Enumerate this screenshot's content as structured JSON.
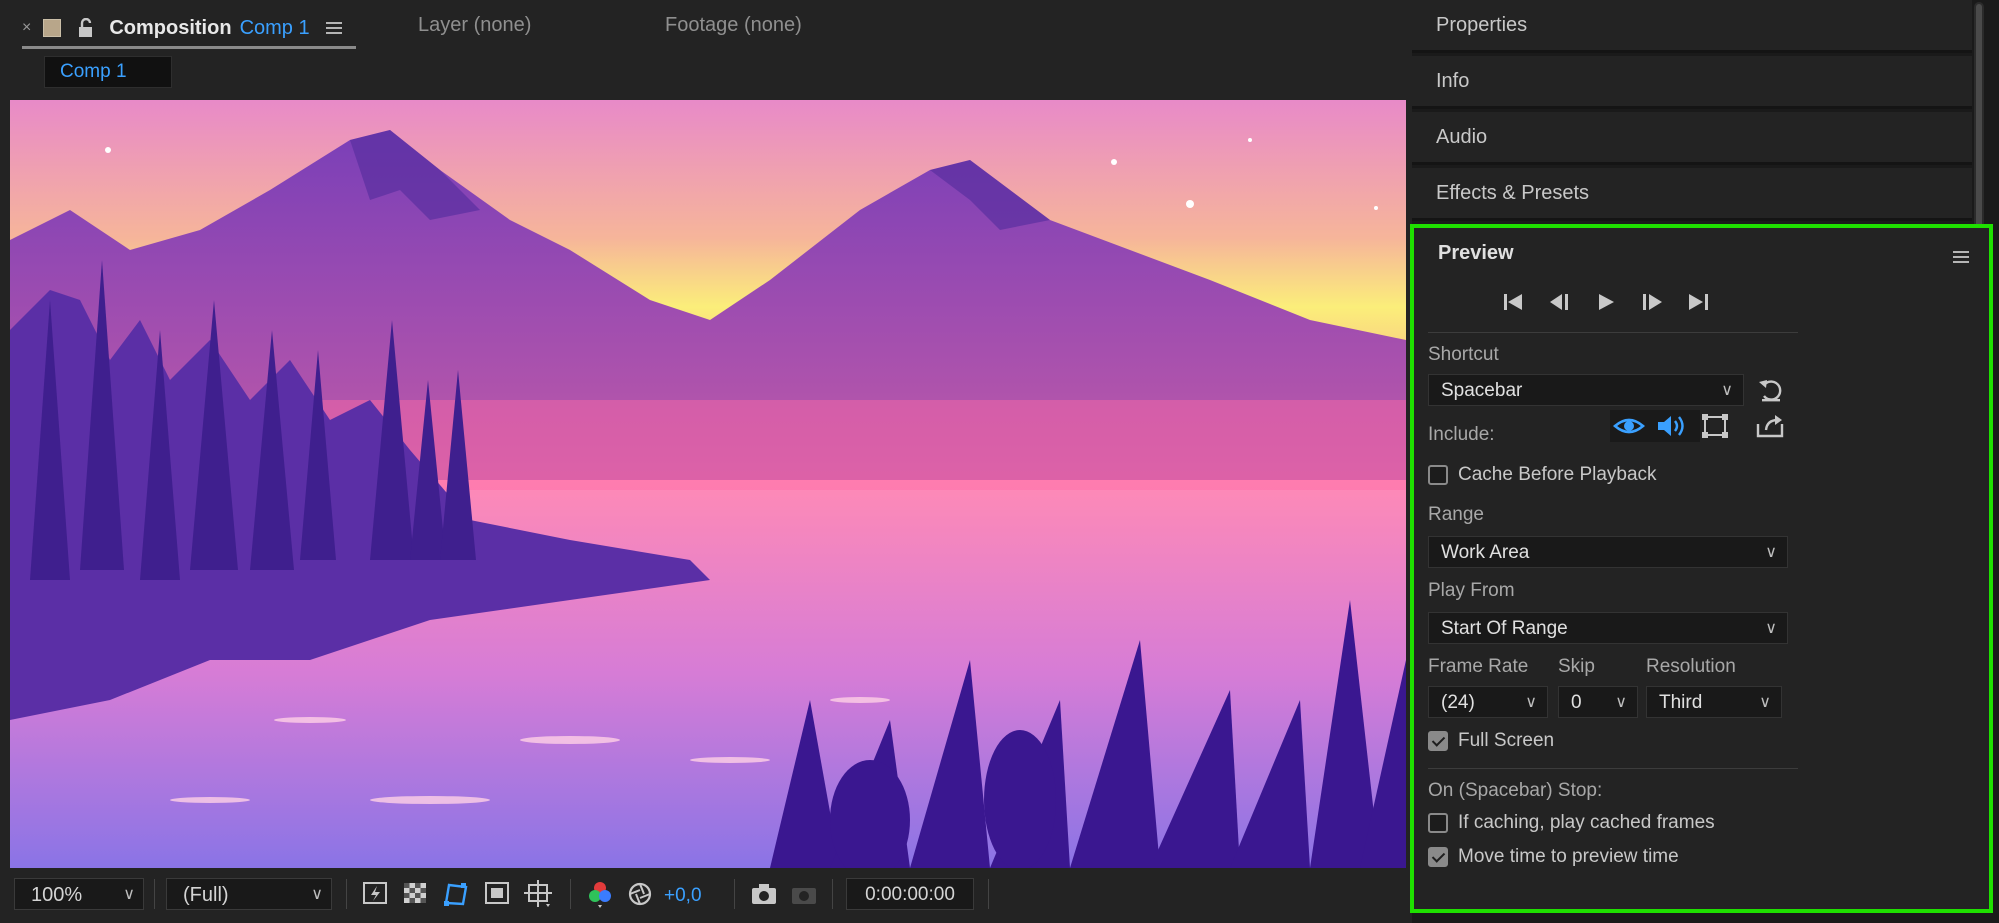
{
  "composition_panel": {
    "tab_composition_label": "Composition",
    "tab_composition_name": "Comp 1",
    "tab_layer": "Layer (none)",
    "tab_footage": "Footage (none)",
    "breadcrumb": "Comp 1"
  },
  "bottom_bar": {
    "zoom": "100%",
    "resolution": "(Full)",
    "exposure": "+0,0",
    "timecode": "0:00:00:00"
  },
  "right_panels": {
    "items": [
      {
        "label": "Properties"
      },
      {
        "label": "Info"
      },
      {
        "label": "Audio"
      },
      {
        "label": "Effects & Presets"
      }
    ]
  },
  "preview": {
    "title": "Preview",
    "shortcut_label": "Shortcut",
    "shortcut_value": "Spacebar",
    "include_label": "Include:",
    "cache_before_playback": "Cache Before Playback",
    "cache_before_playback_checked": false,
    "range_label": "Range",
    "range_value": "Work Area",
    "play_from_label": "Play From",
    "play_from_value": "Start Of Range",
    "frame_rate_label": "Frame Rate",
    "frame_rate_value": "(24)",
    "skip_label": "Skip",
    "skip_value": "0",
    "resolution_label": "Resolution",
    "resolution_value": "Third",
    "full_screen": "Full Screen",
    "full_screen_checked": true,
    "stop_label": "On (Spacebar) Stop:",
    "if_caching": "If caching, play cached frames",
    "if_caching_checked": false,
    "move_time": "Move time to preview time",
    "move_time_checked": true
  },
  "colors": {
    "accent_blue": "#3aa0ff",
    "highlight_green": "#1fe000",
    "panel_bg": "#232323"
  }
}
